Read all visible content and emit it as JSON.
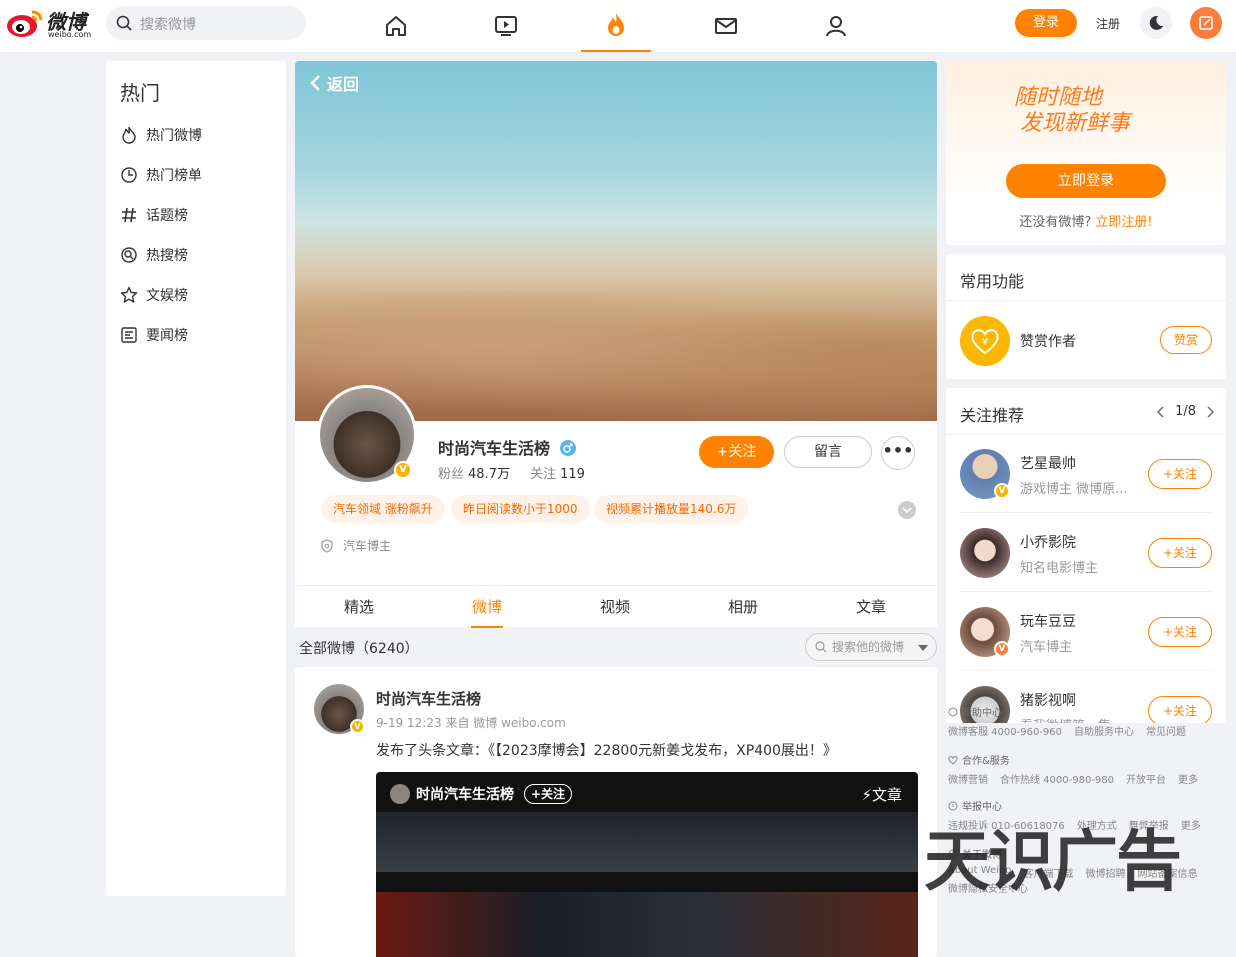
{
  "logo": {
    "text": "微博",
    "sub": "weibo.com"
  },
  "search": {
    "placeholder": "搜索微博"
  },
  "topnav": [
    {
      "icon": "home-icon"
    },
    {
      "icon": "video-icon"
    },
    {
      "icon": "fire-icon",
      "active": true
    },
    {
      "icon": "mail-icon"
    },
    {
      "icon": "user-icon"
    }
  ],
  "header": {
    "login": "登录",
    "register": "注册"
  },
  "leftnav": {
    "title": "热门",
    "items": [
      {
        "label": "热门微博",
        "icon": "flame-icon"
      },
      {
        "label": "热门榜单",
        "icon": "clock-icon"
      },
      {
        "label": "话题榜",
        "icon": "hashtag-icon"
      },
      {
        "label": "热搜榜",
        "icon": "search-circle-icon"
      },
      {
        "label": "文娱榜",
        "icon": "star-icon"
      },
      {
        "label": "要闻榜",
        "icon": "news-icon"
      }
    ]
  },
  "profile": {
    "back": "返回",
    "name": "时尚汽车生活榜",
    "fans_label": "粉丝",
    "fans": "48.7万",
    "following_label": "关注",
    "following": "119",
    "follow_btn": "+关注",
    "message_btn": "留言",
    "more_btn": "•••",
    "tags": [
      "汽车领域 涨粉飙升",
      "昨日阅读数小于1000",
      "视频累计播放量140.6万"
    ],
    "verify_type": "汽车博主"
  },
  "tabs": [
    "精选",
    "微博",
    "视频",
    "相册",
    "文章"
  ],
  "feed": {
    "all_label": "全部微博（6240）",
    "search_placeholder": "搜索他的微博"
  },
  "post": {
    "name": "时尚汽车生活榜",
    "meta": "9-19 12:23 来自 微博 weibo.com",
    "text": "发布了头条文章：《【2023摩博会】22800元新姜戈发布，XP400展出！》",
    "card_name": "时尚汽车生活榜",
    "card_follow": "+关注",
    "card_type": "文章"
  },
  "login_card": {
    "slogan1": "随时随地",
    "slogan2": "发现新鲜事",
    "button": "立即登录",
    "no_account": "还没有微博?",
    "register_link": "立即注册!"
  },
  "functions": {
    "title": "常用功能",
    "reward_label": "赞赏作者",
    "reward_btn": "赞赏"
  },
  "recommend": {
    "title": "关注推荐",
    "pager": "1/8",
    "items": [
      {
        "name": "艺星最帅",
        "desc": "游戏博主 微博原...",
        "btn": "+关注",
        "color": "#7a9bc4"
      },
      {
        "name": "小乔影院",
        "desc": "知名电影博主",
        "btn": "+关注",
        "color": "#c9a5a0"
      },
      {
        "name": "玩车豆豆",
        "desc": "汽车博主",
        "btn": "+关注",
        "color": "#d7b7a4"
      },
      {
        "name": "猪影视啊",
        "desc": "看我微博第一集",
        "btn": "+关注",
        "color": "#9a8f88"
      }
    ]
  },
  "footer": {
    "help_title": "帮助中心",
    "help_links": [
      "微博客服 4000-960-960",
      "自助服务中心",
      "常见问题"
    ],
    "coop_title": "合作&服务",
    "coop_links": [
      "微博营销",
      "合作热线 4000-980-980",
      "开放平台",
      "更多"
    ],
    "report_title": "举报中心",
    "report_links": [
      "违规投诉 010-60618076",
      "处理方式",
      "舞弊举报",
      "更多"
    ],
    "about_title": "关于微博",
    "about_links": [
      "About Weibo",
      "客户端下载",
      "微博招聘",
      "网站备案信息"
    ],
    "about_links2": [
      "微博隐私安全中心"
    ]
  },
  "watermark": "天识广告"
}
